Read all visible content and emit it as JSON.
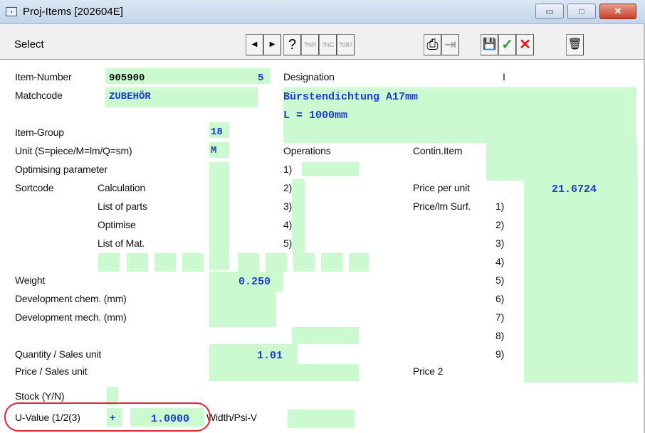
{
  "window": {
    "title": "Proj-Items  [202604E]",
    "minimize": "▭",
    "maximize": "□",
    "close": "✕"
  },
  "toolbar": {
    "select_label": "Select",
    "prev": "◀",
    "next": "▶",
    "help": "?",
    "f5": "?NR",
    "f6": "?NC",
    "f7": "?087",
    "print": "⎙",
    "export": "⇥",
    "save": "💾",
    "ok": "✓",
    "cancel": "✕",
    "delete": "🗑"
  },
  "colors": {
    "field_bg": "#ccfad0",
    "value_text": "#1a3bd6",
    "highlight": "#e4262f",
    "ok": "#22a33a",
    "cancel": "#e01b1b"
  },
  "labels": {
    "item_number": "Item-Number",
    "matchcode": "Matchcode",
    "item_group": "Item-Group",
    "unit": "Unit (S=piece/M=lm/Q=sm)",
    "optimising_parameter": "Optimising parameter",
    "sortcode": "Sortcode",
    "calculation": "Calculation",
    "list_of_parts": "List of parts",
    "optimise": "Optimise",
    "list_of_mat": "List of Mat.",
    "weight": "Weight",
    "dev_chem": "Development chem. (mm)",
    "dev_mech": "Development mech. (mm)",
    "qty_sales_unit": "Quantity / Sales unit",
    "price_sales_unit": "Price / Sales unit",
    "stock": "Stock (Y/N)",
    "u_value": "U-Value (1/2(3)",
    "width_psi": "Width/Psi-V",
    "designation": "Designation",
    "operations": "Operations",
    "contin_item": "Contin.Item",
    "price_per_unit": "Price per unit",
    "price_lm_surf": "Price/lm Surf.",
    "price2": "Price 2",
    "op_numbers": [
      "1)",
      "2)",
      "3)",
      "4)",
      "5)"
    ],
    "surf_numbers": [
      "1)",
      "2)",
      "3)",
      "4)",
      "5)",
      "6)",
      "7)",
      "8)",
      "9)"
    ],
    "designation_cursor": "I"
  },
  "values": {
    "item_number": "905900",
    "item_number_suffix": "5",
    "matchcode": "ZUBEHÖR",
    "designation_line1": "Bürstendichtung A17mm",
    "designation_line2": "L = 1000mm",
    "item_group": "18",
    "unit": "M",
    "weight": "0.250",
    "qty_sales_unit": "1.01",
    "price_per_unit": "21.6724",
    "u_value_sign": "+",
    "u_value": "1.0000"
  }
}
